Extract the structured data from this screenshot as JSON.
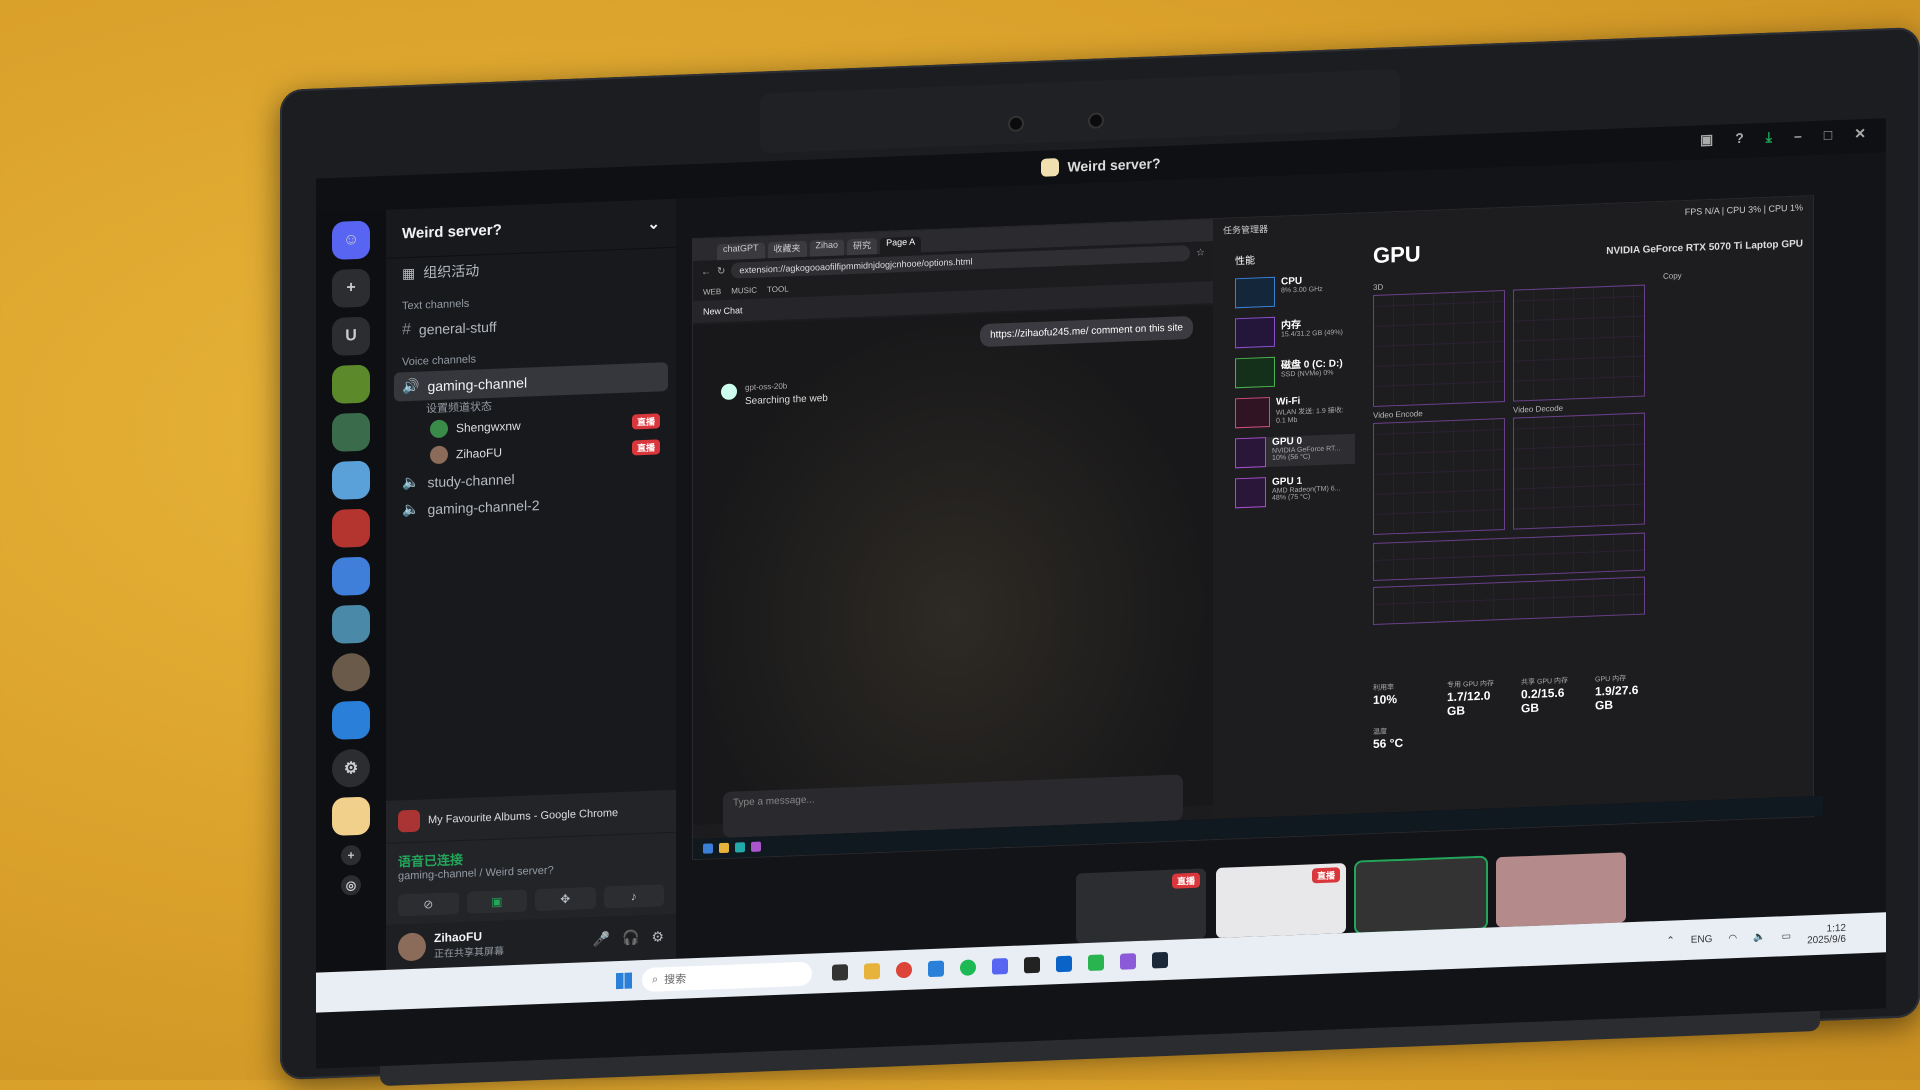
{
  "discord": {
    "window_title": "Weird server?",
    "server_name": "Weird server?",
    "events_label": "组织活动",
    "text_category": "Text channels",
    "voice_category": "Voice channels",
    "text_channels": [
      "general-stuff"
    ],
    "active_voice": {
      "name": "gaming-channel",
      "status": "设置频道状态",
      "members": [
        {
          "name": "Shengwxnw",
          "badge": "直播"
        },
        {
          "name": "ZihaoFU",
          "badge": "直播"
        }
      ]
    },
    "other_voice": [
      "study-channel",
      "gaming-channel-2"
    ],
    "stream_label": "My Favourite Albums - Google Chrome",
    "voice_connected": "语音已连接",
    "voice_path": "gaming-channel / Weird server?",
    "user": {
      "name": "ZihaoFU",
      "status": "正在共享其屏幕"
    },
    "rail_letter": "U",
    "live_badge": "直播"
  },
  "shared_screen": {
    "chrome": {
      "tabs": [
        "chatGPT",
        "收藏夹",
        "Zihao",
        "研究",
        "Page A"
      ],
      "url": "extension://agkogooaofilfipmmidnjdogjcnhooe/options.html",
      "bookmarks": [
        "WEB",
        "MUSIC",
        "TOOL"
      ],
      "new_chat": "New Chat",
      "user_message": "https://zihaofu245.me/ comment on this site",
      "bot_name": "gpt-oss-20b",
      "bot_message": "Searching the web",
      "composer_placeholder": "Type a message..."
    },
    "task_manager": {
      "title": "任务管理器",
      "section": "性能",
      "top_stats": "FPS N/A  |  CPU 3%  |  CPU 1%",
      "gpu_label": "GPU",
      "gpu_model": "NVIDIA GeForce RTX 5070 Ti Laptop GPU",
      "items": [
        {
          "name": "CPU",
          "detail": "8% 3.00 GHz"
        },
        {
          "name": "内存",
          "detail": "15.4/31.2 GB (49%)"
        },
        {
          "name": "磁盘 0 (C: D:)",
          "detail": "SSD (NVMe) 0%"
        },
        {
          "name": "Wi-Fi",
          "detail": "WLAN 发送: 1.9 接收: 0.1 Mb"
        },
        {
          "name": "GPU 0",
          "detail": "NVIDIA GeForce RT... 10% (56 °C)"
        },
        {
          "name": "GPU 1",
          "detail": "AMD Radeon(TM) 6... 48% (75 °C)"
        }
      ],
      "graph_labels": [
        "3D",
        "Copy",
        "Video Encode",
        "Video Decode"
      ],
      "stats": [
        {
          "k": "利用率",
          "v": "10%"
        },
        {
          "k": "专用 GPU 内存",
          "v": "1.7/12.0 GB"
        },
        {
          "k": "共享 GPU 内存",
          "v": "0.2/15.6 GB"
        },
        {
          "k": "GPU 内存",
          "v": "1.9/27.6 GB"
        },
        {
          "k": "温度",
          "v": "56 °C"
        }
      ]
    }
  },
  "taskbar": {
    "search_placeholder": "搜索",
    "lang": "ENG",
    "time": "1:12",
    "date": "2025/9/6"
  }
}
